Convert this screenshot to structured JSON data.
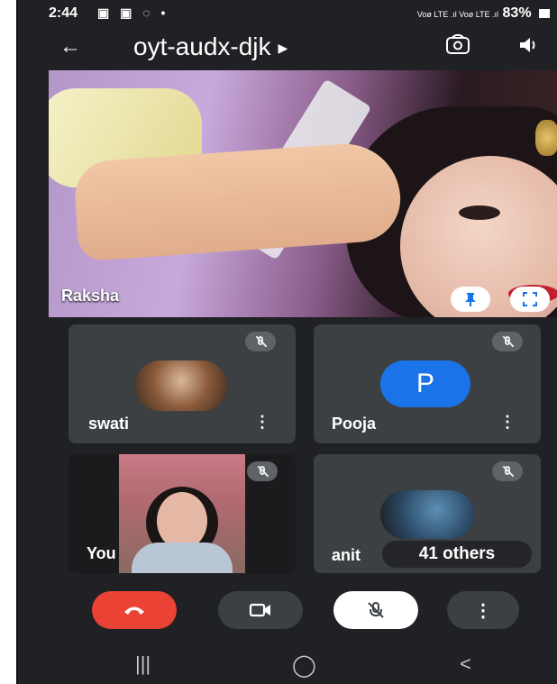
{
  "status_bar": {
    "time": "2:44",
    "left_icons": "▣ ▣ ◌ •",
    "network": "Voø LTE .ıl Voø LTE .ıl",
    "battery": "83%"
  },
  "toolbar": {
    "back_icon": "arrow-left-icon",
    "meeting_code": "oyt-audx-djk",
    "switch_camera_icon": "camera-switch-icon",
    "audio_icon": "speaker-icon"
  },
  "main_video": {
    "participant": "Raksha"
  },
  "participants": [
    {
      "name": "swati",
      "muted": true
    },
    {
      "name": "Pooja",
      "muted": true,
      "initial": "P"
    },
    {
      "name": "You",
      "muted": true
    },
    {
      "name": "anit",
      "muted": true,
      "overflow_label": "41 others"
    }
  ],
  "controls": {
    "end_call_color": "#ea4335",
    "mic_active_bg": "#ffffff",
    "button_bg": "#3c4043"
  },
  "nav": {
    "recents": "|||",
    "home": "◯",
    "back": "<"
  }
}
